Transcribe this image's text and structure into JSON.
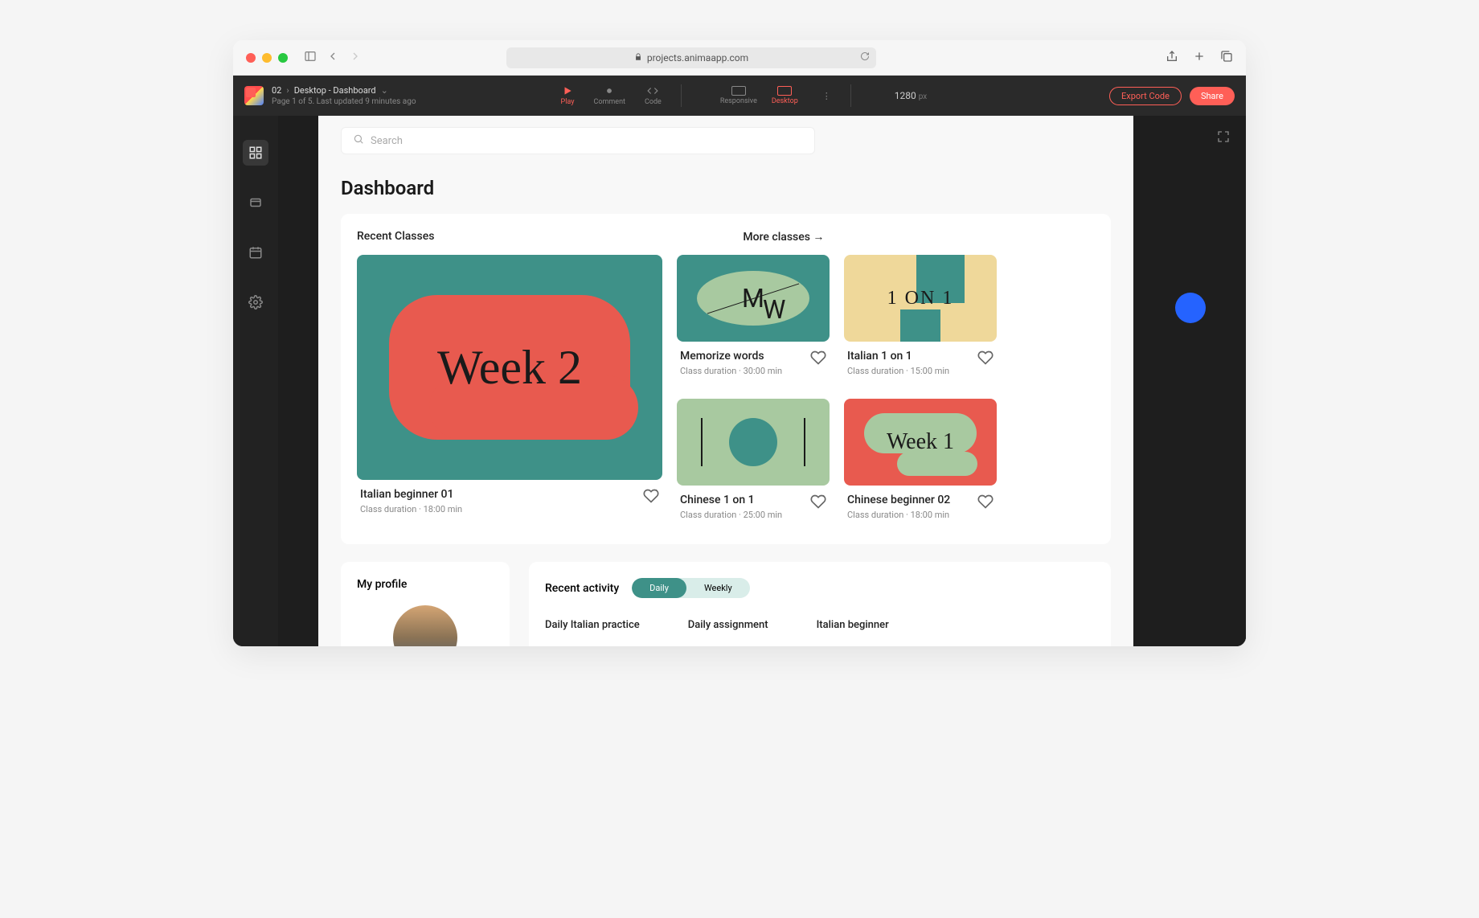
{
  "browser": {
    "url": "projects.animaapp.com"
  },
  "header": {
    "breadcrumb_project": "02",
    "breadcrumb_page": "Desktop - Dashboard",
    "subtext": "Page 1 of 5. Last updated 9 minutes ago",
    "tools": {
      "play": "Play",
      "comment": "Comment",
      "code": "Code"
    },
    "viewport": {
      "responsive": "Responsive",
      "desktop": "Desktop"
    },
    "width_value": "1280",
    "width_unit": "px",
    "export_label": "Export Code",
    "share_label": "Share"
  },
  "search": {
    "placeholder": "Search"
  },
  "dashboard": {
    "title": "Dashboard",
    "recent_label": "Recent Classes",
    "more_label": "More classes →",
    "featured": {
      "thumb_text": "Week 2",
      "title": "Italian beginner 01",
      "subtitle": "Class duration ·  18:00 min"
    },
    "cards": [
      {
        "thumb_text_1": "M",
        "thumb_text_2": "W",
        "title": "Memorize words",
        "subtitle": "Class duration · 30:00 min"
      },
      {
        "thumb_text": "1 ON 1",
        "title": "Italian 1 on 1",
        "subtitle": "Class duration · 15:00 min"
      },
      {
        "thumb_text": "",
        "title": "Chinese 1 on 1",
        "subtitle": "Class duration · 25:00 min"
      },
      {
        "thumb_text": "Week 1",
        "title": "Chinese beginner 02",
        "subtitle": "Class duration · 18:00 min"
      }
    ]
  },
  "profile": {
    "title": "My profile"
  },
  "activity": {
    "title": "Recent activity",
    "toggle_daily": "Daily",
    "toggle_weekly": "Weekly",
    "cols": [
      "Daily Italian practice",
      "Daily assignment",
      "Italian beginner"
    ]
  }
}
